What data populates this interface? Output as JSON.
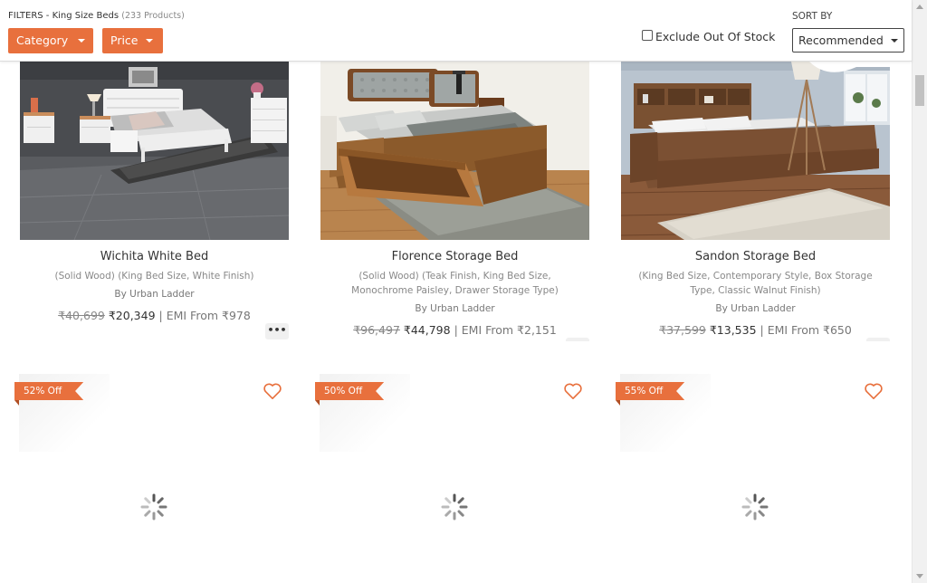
{
  "filters": {
    "title": "FILTERS - King Size Beds",
    "count": "(233 Products)",
    "category_label": "Category",
    "price_label": "Price",
    "exclude_label": "Exclude Out Of Stock",
    "exclude_checked": false,
    "sort_label": "SORT BY",
    "sort_value": "Recommended"
  },
  "products": [
    {
      "name": "Wichita White Bed",
      "desc": "(Solid Wood) (King Bed Size, White Finish)",
      "by": "By Urban Ladder",
      "old_price": "₹40,699",
      "price": "₹20,349",
      "emi": "| EMI From ₹978"
    },
    {
      "name": "Florence Storage Bed",
      "desc": "(Solid Wood) (Teak Finish, King Bed Size, Monochrome Paisley, Drawer Storage Type)",
      "by": "By Urban Ladder",
      "old_price": "₹96,497",
      "price": "₹44,798",
      "emi": "| EMI From ₹2,151"
    },
    {
      "name": "Sandon Storage Bed",
      "desc": "(King Bed Size, Contemporary Style, Box Storage Type, Classic Walnut Finish)",
      "by": "By Urban Ladder",
      "old_price": "₹37,599",
      "price": "₹13,535",
      "emi": "| EMI From ₹650"
    }
  ],
  "more_label": "•••",
  "row2": [
    {
      "discount": "52% Off"
    },
    {
      "discount": "50% Off"
    },
    {
      "discount": "55% Off"
    }
  ],
  "colors": {
    "accent": "#e8703d"
  }
}
